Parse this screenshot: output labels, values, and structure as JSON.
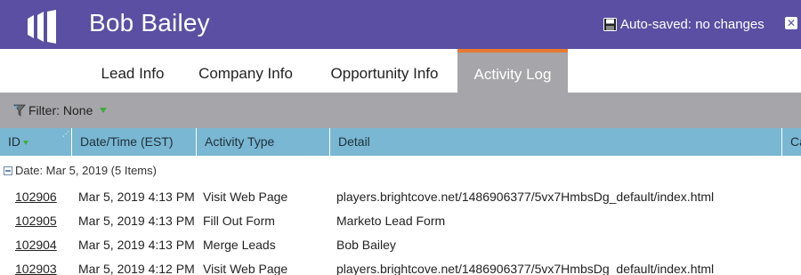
{
  "header": {
    "title": "Bob Bailey",
    "autosave": "Auto-saved: no changes",
    "colors": {
      "header_bg": "#5a4fa2",
      "tab_accent": "#e67a30"
    }
  },
  "tabs": [
    {
      "label": "Lead Info",
      "active": false
    },
    {
      "label": "Company Info",
      "active": false
    },
    {
      "label": "Opportunity Info",
      "active": false
    },
    {
      "label": "Activity Log",
      "active": true
    }
  ],
  "filter": {
    "label": "Filter: None"
  },
  "grid": {
    "columns": [
      "ID",
      "Date/Time (EST)",
      "Activity Type",
      "Detail",
      "Ca"
    ],
    "group": {
      "label": "Date: Mar 5, 2019 (5 Items)"
    },
    "rows": [
      {
        "id": "102906",
        "datetime": "Mar 5, 2019 4:13 PM",
        "type": "Visit Web Page",
        "detail": "players.brightcove.net/1486906377/5vx7HmbsDg_default/index.html"
      },
      {
        "id": "102905",
        "datetime": "Mar 5, 2019 4:13 PM",
        "type": "Fill Out Form",
        "detail": "Marketo Lead Form"
      },
      {
        "id": "102904",
        "datetime": "Mar 5, 2019 4:13 PM",
        "type": "Merge Leads",
        "detail": "Bob Bailey"
      },
      {
        "id": "102903",
        "datetime": "Mar 5, 2019 4:12 PM",
        "type": "Visit Web Page",
        "detail": "players.brightcove.net/1486906377/5vx7HmbsDg_default/index.html"
      }
    ]
  },
  "icons": {
    "logo": "marketo-logo-icon",
    "save": "floppy-disk-icon",
    "close": "close-icon",
    "filter": "filter-funnel-icon",
    "sort": "sort-down-icon",
    "collapse": "collapse-minus-icon"
  }
}
